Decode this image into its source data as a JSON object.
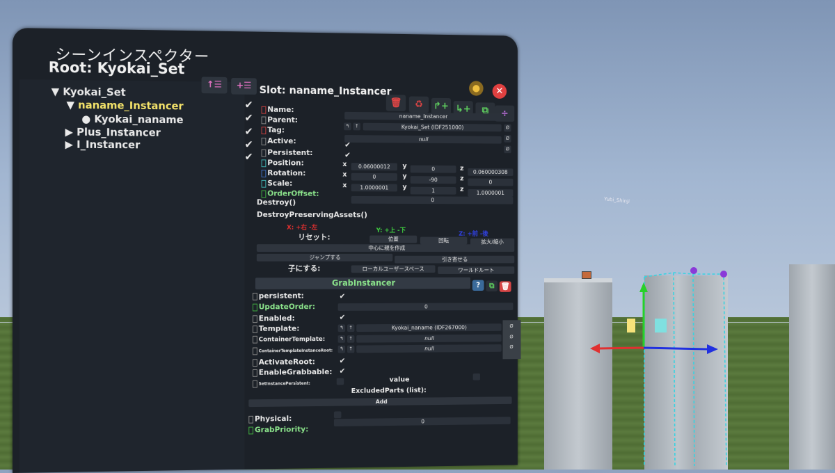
{
  "panel": {
    "title": "シーンインスペクター",
    "root_label": "Root: Kyokai_Set"
  },
  "tree": {
    "items": [
      {
        "label": "Kyokai_Set",
        "prefix": "▼"
      },
      {
        "label": "naname_Instancer",
        "prefix": "▼"
      },
      {
        "label": "Kyokai_naname",
        "prefix": "●"
      },
      {
        "label": "Plus_Instancer",
        "prefix": "▶"
      },
      {
        "label": "I_Instancer",
        "prefix": "▶"
      }
    ],
    "check": "✔"
  },
  "slot": {
    "title": "Slot: naname_Instancer",
    "fields": {
      "name_label": "Name:",
      "name_value": "naname_Instancer",
      "parent_label": "Parent:",
      "parent_value": "Kyokai_Set (IDF251000)",
      "tag_label": "Tag:",
      "tag_value": "null",
      "active_label": "Active:",
      "persistent_label": "Persistent:",
      "position_label": "Position:",
      "rotation_label": "Rotation:",
      "scale_label": "Scale:",
      "orderoffset_label": "OrderOffset:",
      "orderoffset_value": "0",
      "position": {
        "x": "0.06000012",
        "y": "0",
        "z": "0.060000308"
      },
      "rotation": {
        "x": "0",
        "y": "-90",
        "z": "0"
      },
      "scale": {
        "x": "1.0000001",
        "y": "1",
        "z": "1.0000001"
      }
    },
    "axis": {
      "x": "x",
      "y": "y",
      "z": "z"
    },
    "actions": {
      "destroy": "Destroy()",
      "destroy_preserving": "DestroyPreservingAssets()"
    },
    "hints": {
      "x_hint": "X: +右 -左",
      "y_hint": "Y: +上 -下",
      "z_hint": "Z: +前 -後"
    },
    "reset_label": "リセット:",
    "reset_buttons": {
      "position": "位置",
      "rotation": "回転",
      "scale": "拡大/縮小"
    },
    "center_parent": "中心に親を作成",
    "jump_to": "ジャンプする",
    "bring_to": "引き寄せる",
    "make_child_label": "子にする:",
    "local_userspace": "ローカルユーザースペース",
    "world_root": "ワールドルート"
  },
  "component": {
    "title": "GrabInstancer",
    "persistent_label": "persistent:",
    "update_order_label": "UpdateOrder:",
    "update_order_value": "0",
    "enabled_label": "Enabled:",
    "template_label": "Template:",
    "template_value": "Kyokai_naname (IDF267000)",
    "container_template_label": "ContainerTemplate:",
    "container_template_value": "null",
    "container_root_label": "ContainerTemplateInstanceRoot:",
    "container_root_value": "null",
    "activate_root_label": "ActivateRoot:",
    "enable_grabbable_label": "EnableGrabbable:",
    "set_instance_persistent_label": "SetInstancePersistent:",
    "value_label": "value",
    "excluded_parts_label": "ExcludedParts (list):",
    "add_label": "Add",
    "physical_label": "Physical:",
    "grab_priority_label": "GrabPriority:",
    "grab_priority_value": "0"
  },
  "icons": {
    "null_clear": "Ø",
    "ptr_up": "↑",
    "ptr_back": "↰",
    "help": "?",
    "pin": "pin-icon",
    "close": "close-icon"
  },
  "scene": {
    "far_label": "Yubi_Shinji"
  },
  "colors": {
    "panel_bg": "#1c2128",
    "selected": "#f4e36a",
    "green_label": "#8be38b",
    "delete_red": "#d64545",
    "close_red": "#e04040"
  }
}
